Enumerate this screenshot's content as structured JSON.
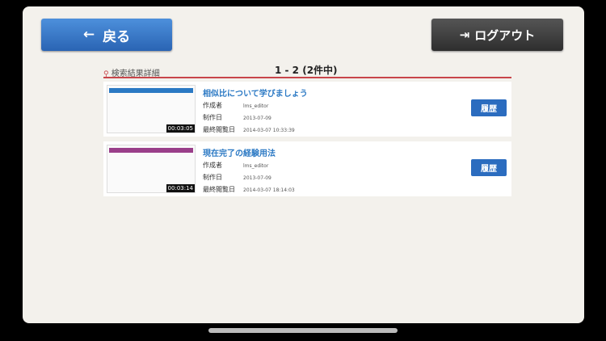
{
  "header": {
    "back_label": "戻る",
    "logout_label": "ログアウト"
  },
  "results": {
    "label": "検索結果詳細",
    "count": "1 - 2 (2件中)",
    "items": [
      {
        "title": "相似比について学びましょう",
        "duration": "00:03:05",
        "author_label": "作成者",
        "author": "lms_editor",
        "created_label": "制作日",
        "created": "2013-07-09",
        "viewed_label": "最終閲覧日",
        "viewed": "2014-03-07 10:33:39",
        "history_label": "履歴",
        "accent": "#2b79c4"
      },
      {
        "title": "現在完了の経験用法",
        "duration": "00:03:14",
        "author_label": "作成者",
        "author": "lms_editor",
        "created_label": "制作日",
        "created": "2013-07-09",
        "viewed_label": "最終閲覧日",
        "viewed": "2014-03-07 18:14:03",
        "history_label": "履歴",
        "accent": "#9a3f8a"
      }
    ]
  }
}
